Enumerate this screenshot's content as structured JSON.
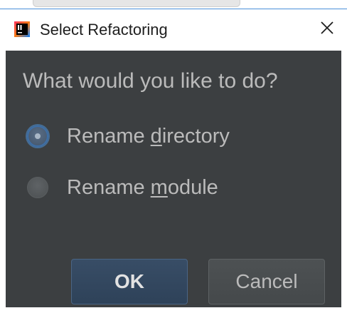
{
  "window": {
    "title": "Select Refactoring",
    "close_glyph": "✕"
  },
  "icons": {
    "app_logo": "intellij-idea-icon",
    "close": "close-icon"
  },
  "dialog": {
    "question": "What would you like to do?",
    "options": [
      {
        "prefix": "Rename ",
        "mnemonic": "d",
        "suffix": "irectory",
        "selected": true
      },
      {
        "prefix": "Rename ",
        "mnemonic": "m",
        "suffix": "odule",
        "selected": false
      }
    ],
    "ok_label": "OK",
    "cancel_label": "Cancel"
  },
  "colors": {
    "dialog_background": "#3c3f41",
    "text": "#bbbbbb",
    "ok_button": "#2e4259",
    "focus_ring": "#3d6fa8"
  }
}
